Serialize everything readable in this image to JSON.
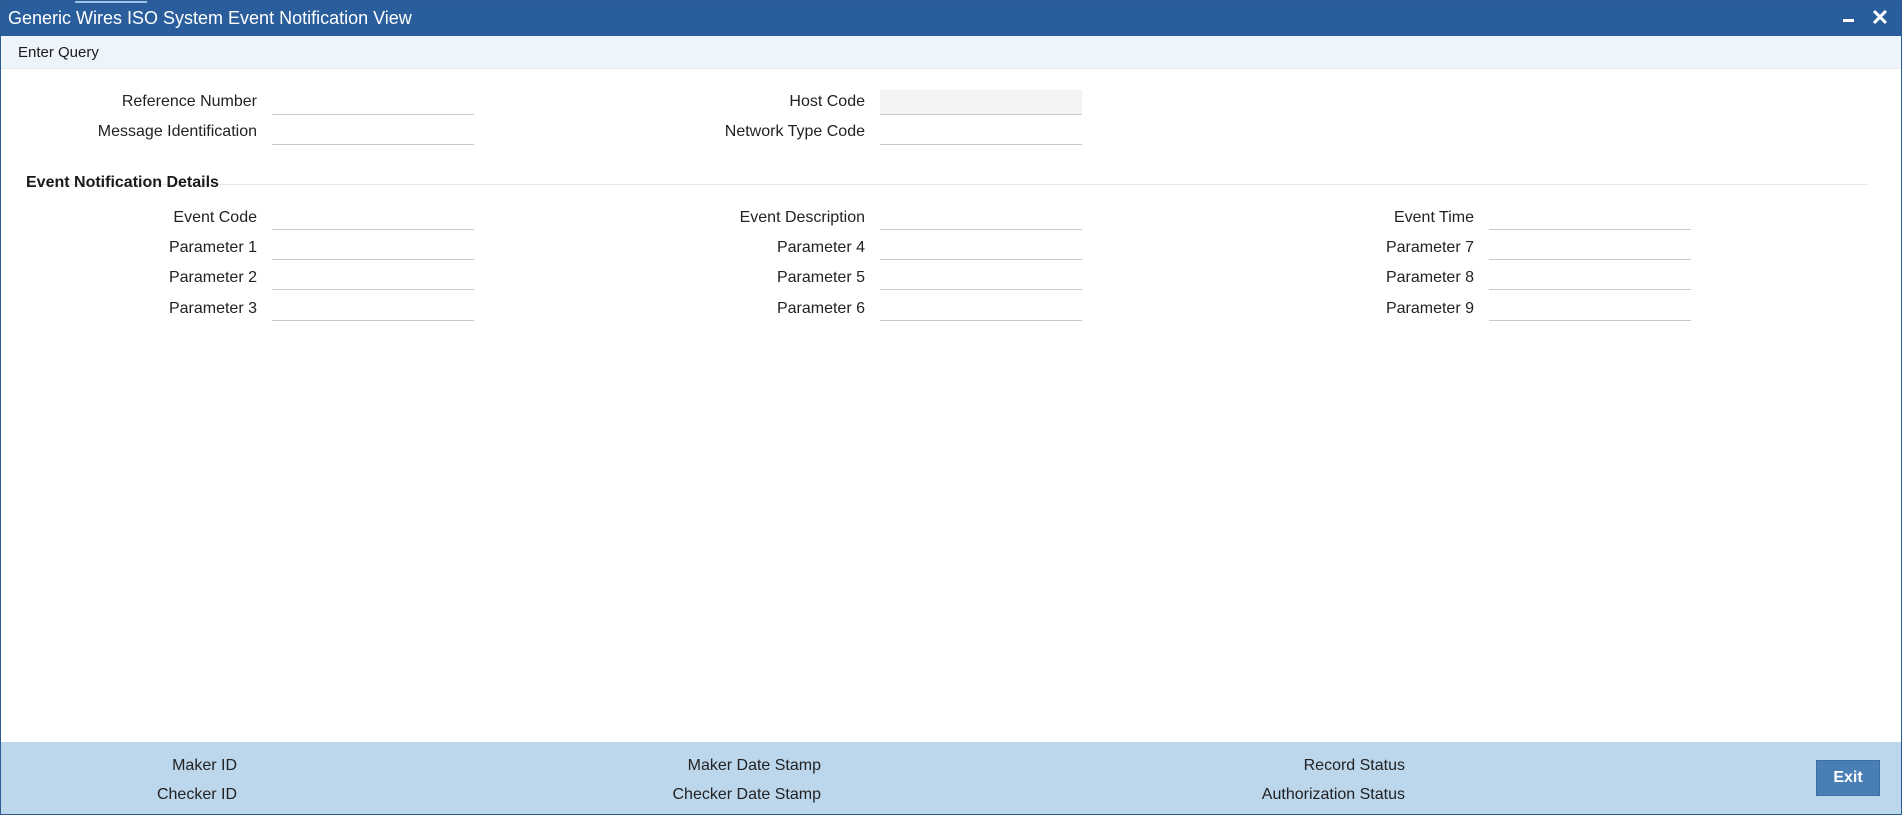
{
  "window": {
    "title": "Generic Wires ISO System Event Notification View",
    "minimize_icon": "minimize-icon",
    "close_icon": "close-icon"
  },
  "toolbar": {
    "enter_query_label": "Enter Query"
  },
  "header_fields": {
    "reference_number": {
      "label": "Reference Number",
      "value": ""
    },
    "message_identification": {
      "label": "Message Identification",
      "value": ""
    },
    "host_code": {
      "label": "Host Code",
      "value": ""
    },
    "network_type_code": {
      "label": "Network Type Code",
      "value": ""
    }
  },
  "event_section": {
    "title": "Event Notification Details",
    "event_code": {
      "label": "Event Code",
      "value": ""
    },
    "event_description": {
      "label": "Event Description",
      "value": ""
    },
    "event_time": {
      "label": "Event Time",
      "value": ""
    },
    "parameters": [
      {
        "label": "Parameter 1",
        "value": ""
      },
      {
        "label": "Parameter 2",
        "value": ""
      },
      {
        "label": "Parameter 3",
        "value": ""
      },
      {
        "label": "Parameter 4",
        "value": ""
      },
      {
        "label": "Parameter 5",
        "value": ""
      },
      {
        "label": "Parameter 6",
        "value": ""
      },
      {
        "label": "Parameter 7",
        "value": ""
      },
      {
        "label": "Parameter 8",
        "value": ""
      },
      {
        "label": "Parameter 9",
        "value": ""
      }
    ]
  },
  "footer": {
    "maker_id": "Maker ID",
    "checker_id": "Checker ID",
    "maker_date_stamp": "Maker Date Stamp",
    "checker_date_stamp": "Checker Date Stamp",
    "record_status": "Record Status",
    "authorization_status": "Authorization Status",
    "exit_label": "Exit"
  },
  "colors": {
    "title_bar": "#2a5d9c",
    "footer_bg": "#bcd6ec",
    "exit_button": "#4a7fb6"
  }
}
